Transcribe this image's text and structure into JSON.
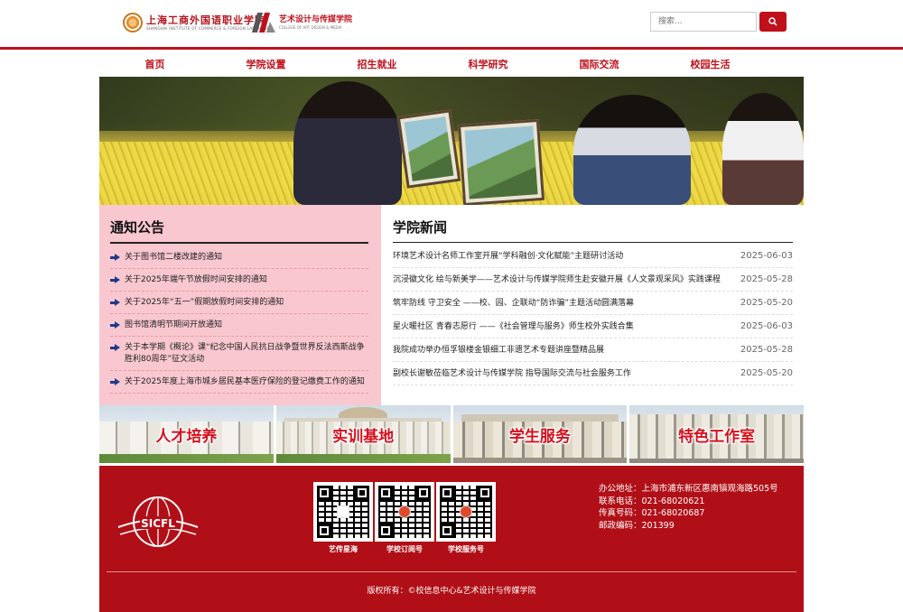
{
  "header": {
    "logo_school_cn": "上海工商外国语职业学院",
    "logo_school_en": "SHANGHAI INSTITUTE OF COMMERCE & FOREIGN LANGUAGES",
    "logo_college_cn": "艺术设计与传媒学院",
    "logo_college_en": "COLLEGE OF ART DESIGN & MEDIA",
    "search_placeholder": "搜索..."
  },
  "nav": {
    "items": [
      "首页",
      "学院设置",
      "招生就业",
      "科学研究",
      "国际交流",
      "校园生活"
    ]
  },
  "notices": {
    "title": "通知公告",
    "items": [
      "关于图书馆二楼改建的通知",
      "关于2025年端午节放假时间安排的通知",
      "关于2025年“五一”假期放假时间安排的通知",
      "图书馆清明节期间开放通知",
      "关于本学期《概论》课“纪念中国人民抗日战争暨世界反法西斯战争胜利80周年”征文活动",
      "关于2025年度上海市城乡居民基本医疗保险的登记缴费工作的通知"
    ]
  },
  "news": {
    "title": "学院新闻",
    "items": [
      {
        "title": "环境艺术设计名师工作室开展“学科融创·文化赋能”主题研讨活动",
        "date": "2025-06-03"
      },
      {
        "title": "沉浸徽文化 绘与新美学——艺术设计与传媒学院师生赴安徽开展《人文景观采风》实践课程",
        "date": "2025-05-28"
      },
      {
        "title": "筑牢防线 守卫安全 ——校、园、企联动“防诈骗”主题活动圆满落幕",
        "date": "2025-05-20"
      },
      {
        "title": "星火暖社区 青春志愿行 ——《社会管理与服务》师生校外实践合集",
        "date": "2025-06-03"
      },
      {
        "title": "我院成功举办恒孚银楼金银细工非遗艺术专题讲座暨精品展",
        "date": "2025-05-28"
      },
      {
        "title": "副校长谢敏莅临艺术设计与传媒学院 指导国际交流与社会服务工作",
        "date": "2025-05-20"
      }
    ]
  },
  "tiles": [
    "人才培养",
    "实训基地",
    "学生服务",
    "特色工作室"
  ],
  "footer": {
    "logo_text": "SICFL",
    "qr_labels": [
      "艺传星海",
      "学校订阅号",
      "学校服务号"
    ],
    "contact": [
      "办公地址：上海市浦东新区惠南镇观海路505号",
      "联系电话：021-68020621",
      "传真号码：021-68020687",
      "邮政编码：201399"
    ],
    "copyright": "版权所有：©校信息中心&艺术设计与传媒学院"
  },
  "colors": {
    "brand_red": "#c0101c",
    "footer_red": "#b10f17",
    "notice_bg": "#f9c7d0"
  }
}
